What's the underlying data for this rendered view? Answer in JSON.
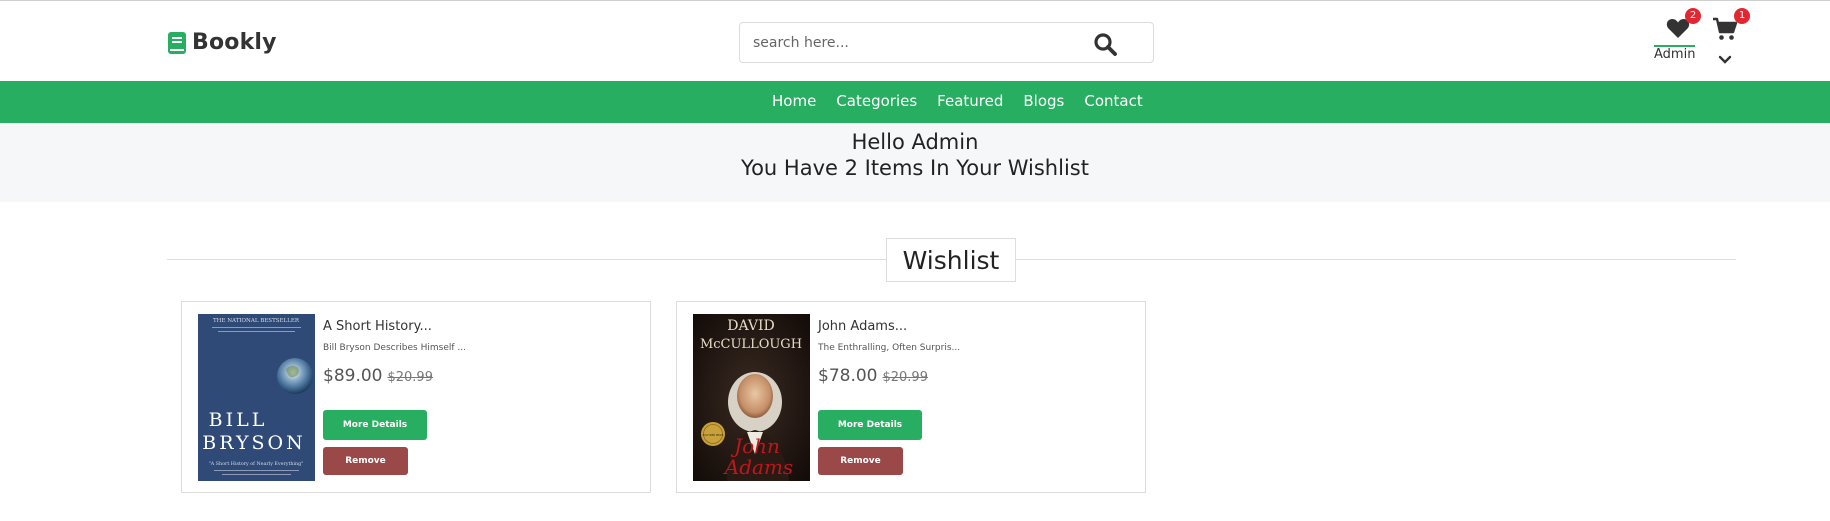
{
  "brand": {
    "name": "Bookly",
    "accent": "#27ae60"
  },
  "search": {
    "placeholder": "search here..."
  },
  "header": {
    "wishlist_count": "2",
    "cart_count": "1",
    "user_label": "Admin",
    "icons": [
      "book-icon",
      "search-icon",
      "heart-icon",
      "cart-icon",
      "chevron-down-icon"
    ]
  },
  "nav": {
    "items": [
      "Home",
      "Categories",
      "Featured",
      "Blogs",
      "Contact"
    ]
  },
  "greeting": {
    "line1": "Hello Admin",
    "line2": "You Have 2 Items In Your Wishlist"
  },
  "section": {
    "title": "Wishlist"
  },
  "wishlist": [
    {
      "title": "A Short History...",
      "description": "Bill Bryson Describes Himself ...",
      "price": "$89.00",
      "old_price": "$20.99",
      "details_label": "More Details",
      "remove_label": "Remove",
      "cover": {
        "top_text": "THE NATIONAL BESTSELLER",
        "author_line1": "BILL",
        "author_line2": "BRYSON",
        "bottom_text": "\"A Short History of Nearly Everything\""
      }
    },
    {
      "title": "John Adams...",
      "description": "The Enthralling, Often Surpris...",
      "price": "$78.00",
      "old_price": "$20.99",
      "details_label": "More Details",
      "remove_label": "Remove",
      "cover": {
        "author_line1": "DAVID",
        "author_line2": "McCULLOUGH",
        "seal_text": "PULITZER PRIZE",
        "title_script1": "John",
        "title_script2": "Adams"
      }
    }
  ]
}
